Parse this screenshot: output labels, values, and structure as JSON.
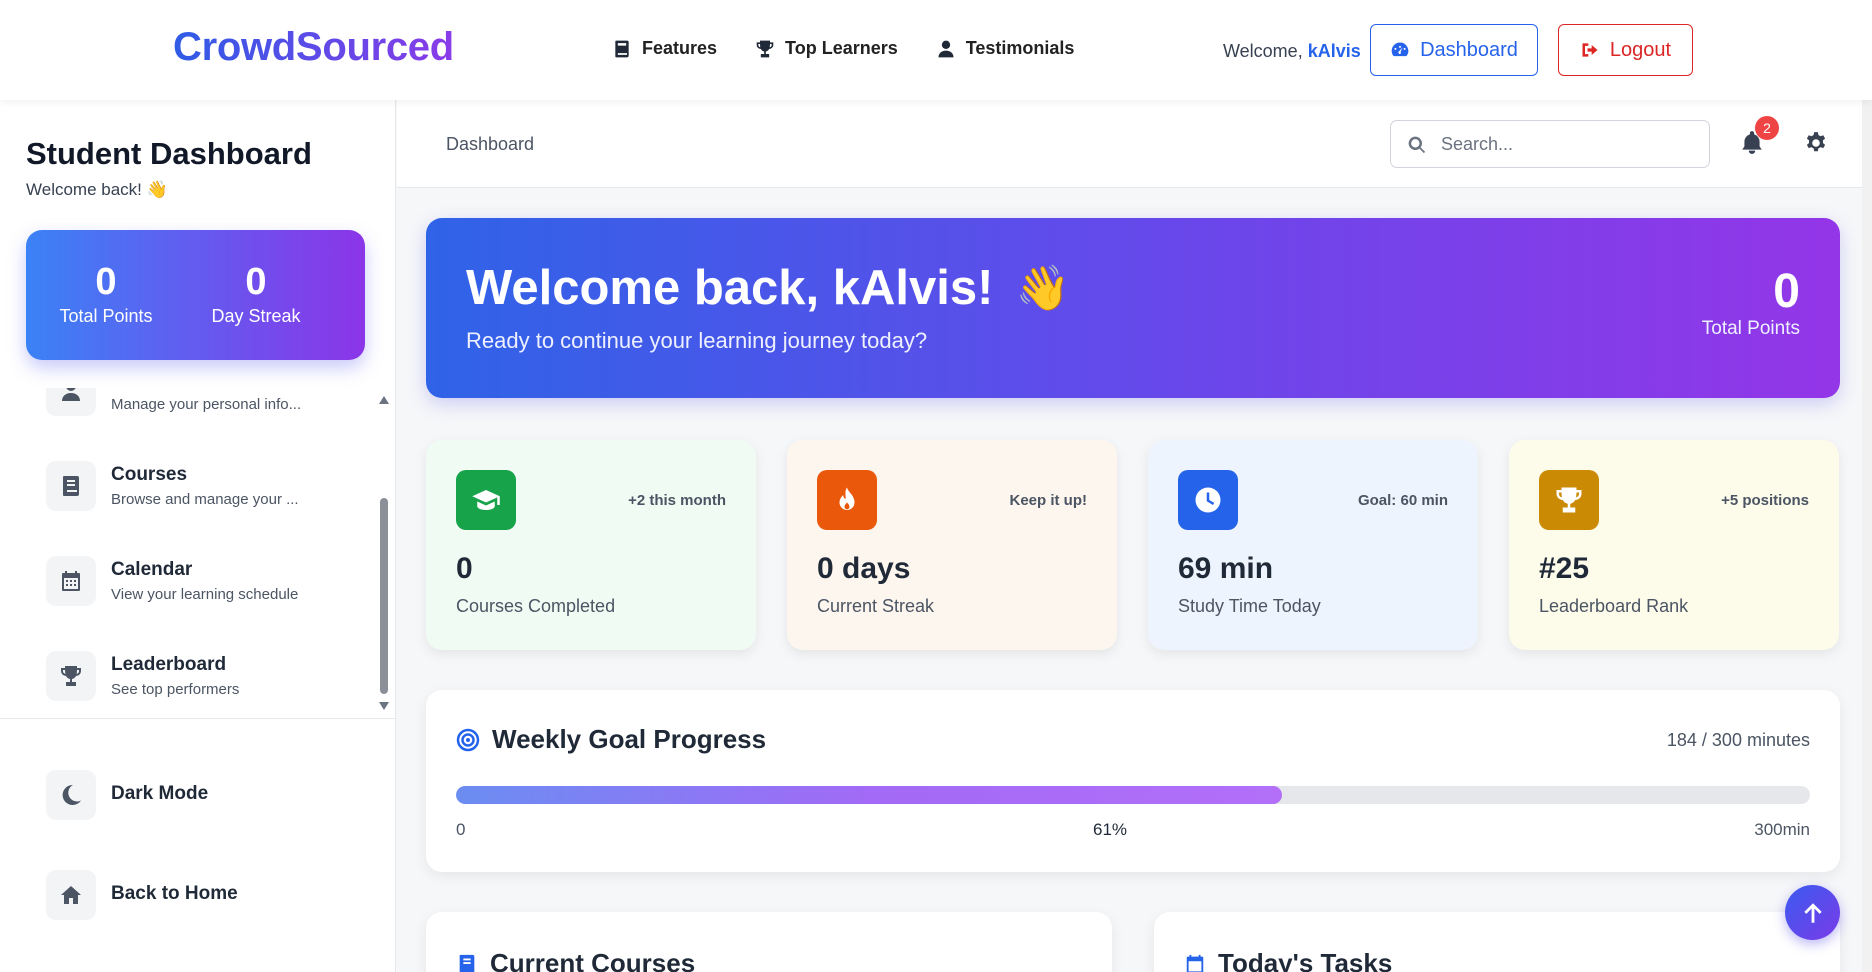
{
  "brand": "CrowdSourced",
  "nav": {
    "links": [
      {
        "label": "Features",
        "icon": "book-icon"
      },
      {
        "label": "Top Learners",
        "icon": "trophy-icon"
      },
      {
        "label": "Testimonials",
        "icon": "user-icon"
      }
    ],
    "welcome_prefix": "Welcome,",
    "username": "kAlvis",
    "dashboard_label": "Dashboard",
    "logout_label": "Logout"
  },
  "sidebar": {
    "title": "Student Dashboard",
    "subtitle": "Welcome back! 👋",
    "stats": [
      {
        "value": "0",
        "label": "Total Points"
      },
      {
        "value": "0",
        "label": "Day Streak"
      }
    ],
    "items": [
      {
        "title": "",
        "desc": "Manage your personal info...",
        "icon": "user-icon"
      },
      {
        "title": "Courses",
        "desc": "Browse and manage your ...",
        "icon": "book-icon"
      },
      {
        "title": "Calendar",
        "desc": "View your learning schedule",
        "icon": "calendar-icon"
      },
      {
        "title": "Leaderboard",
        "desc": "See top performers",
        "icon": "trophy-icon"
      }
    ],
    "bottom": [
      {
        "title": "Dark Mode",
        "icon": "moon-icon"
      },
      {
        "title": "Back to Home",
        "icon": "home-icon"
      }
    ]
  },
  "header": {
    "breadcrumb": "Dashboard",
    "search_placeholder": "Search...",
    "notification_count": "2"
  },
  "hero": {
    "title": "Welcome back, kAlvis!",
    "emoji": "👋",
    "subtitle": "Ready to continue your learning journey today?",
    "points_value": "0",
    "points_label": "Total Points"
  },
  "cards": [
    {
      "value": "0",
      "label": "Courses Completed",
      "note": "+2 this month",
      "icon": "graduation-cap-icon",
      "bg": "#f0fbf4",
      "icon_color": "#16a34a"
    },
    {
      "value": "0 days",
      "label": "Current Streak",
      "note": "Keep it up!",
      "icon": "fire-icon",
      "bg": "#fdf6ee",
      "icon_color": "#ea580c"
    },
    {
      "value": "69 min",
      "label": "Study Time Today",
      "note": "Goal: 60 min",
      "icon": "clock-icon",
      "bg": "#eef4fd",
      "icon_color": "#2563eb"
    },
    {
      "value": "#25",
      "label": "Leaderboard Rank",
      "note": "+5 positions",
      "icon": "trophy-icon",
      "bg": "#fdfbea",
      "icon_color": "#ca8a04"
    }
  ],
  "goal": {
    "title": "Weekly Goal Progress",
    "count": "184 / 300 minutes",
    "progress_fraction": 0.61,
    "min_label": "0",
    "percent_label": "61%",
    "max_label": "300min"
  },
  "lower": {
    "courses_title": "Current Courses",
    "tasks_title": "Today's Tasks"
  },
  "colors": {
    "accent": "#2563eb",
    "danger": "#dc2626",
    "gradient_start": "#3b82f6",
    "gradient_end": "#8b35e8"
  }
}
